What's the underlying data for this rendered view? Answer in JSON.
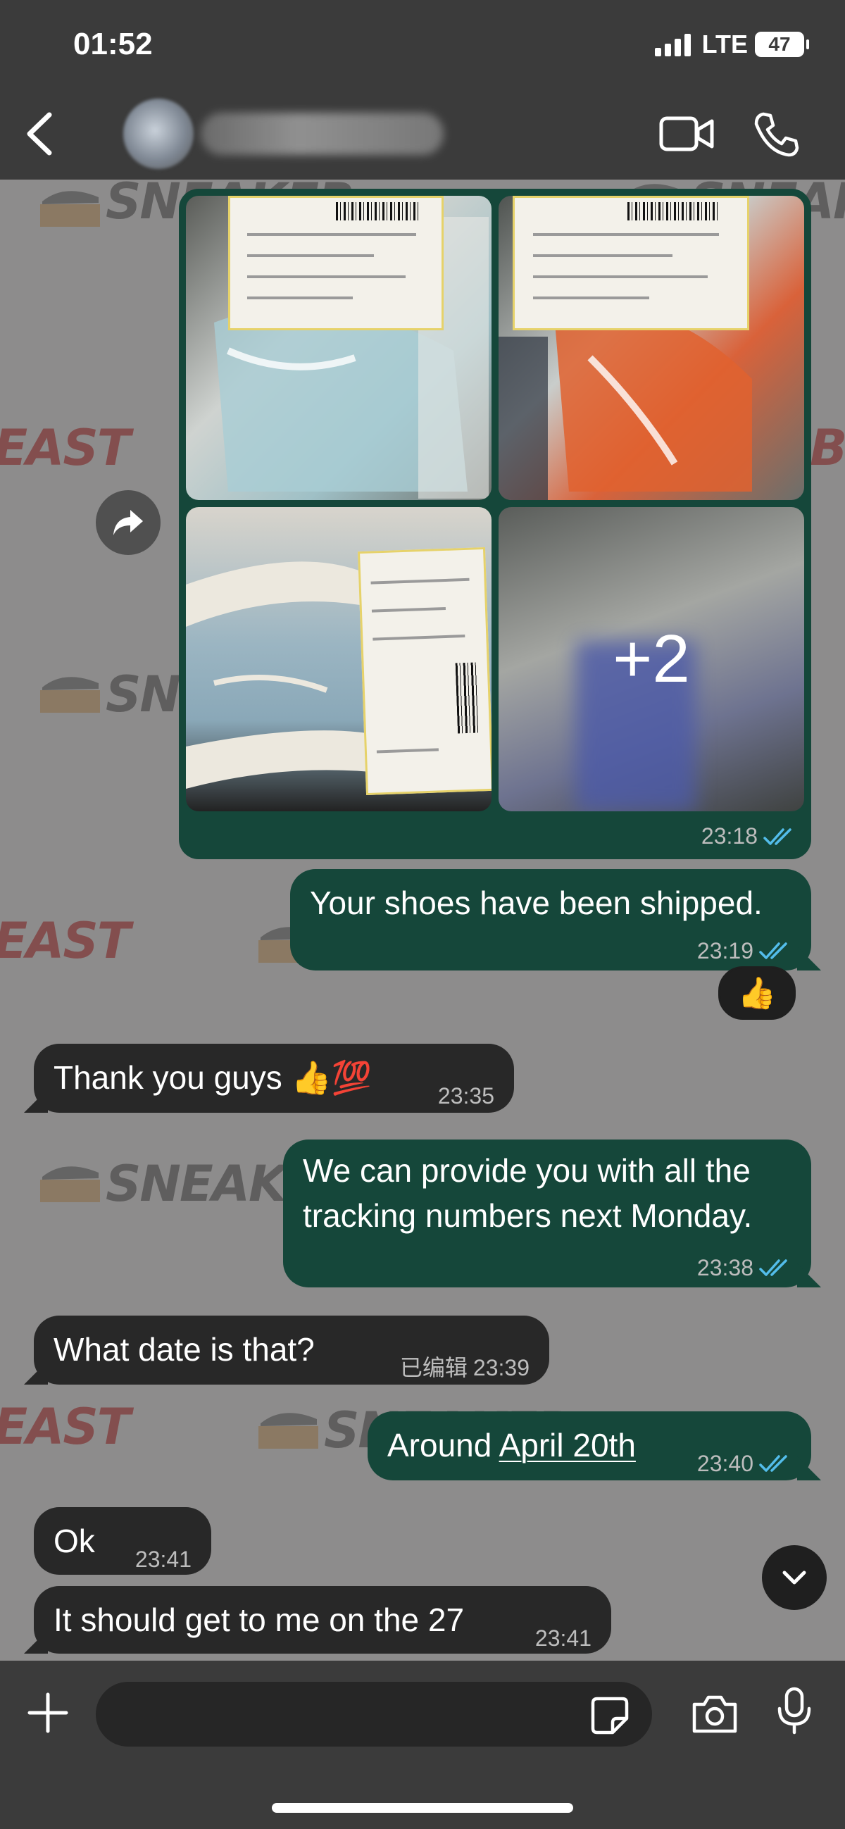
{
  "status_bar": {
    "time": "01:52",
    "network": "LTE",
    "battery": "47"
  },
  "header": {
    "contact_name": "",
    "icons": [
      "chevron-left-icon",
      "video-camera-icon",
      "phone-icon"
    ]
  },
  "wallpaper": {
    "brand_text_a": "SNEAKER",
    "brand_text_b": "BEAST",
    "colors": {
      "dark": "#3a3a3a",
      "red": "#7b1d1d"
    }
  },
  "messages": [
    {
      "id": "album",
      "direction": "out",
      "type": "media",
      "time": "23:18",
      "read": true,
      "extra_count": "+2"
    },
    {
      "id": "m1",
      "direction": "out",
      "text": "Your shoes have been shipped.",
      "time": "23:19",
      "read": true,
      "reaction": "👍"
    },
    {
      "id": "m2",
      "direction": "in",
      "text": "Thank you guys 👍💯",
      "time": "23:35"
    },
    {
      "id": "m3",
      "direction": "out",
      "text_lines": [
        "We can provide you with all the",
        "tracking numbers next Monday."
      ],
      "time": "23:38",
      "read": true
    },
    {
      "id": "m4",
      "direction": "in",
      "text": "What date  is that?",
      "edited": "已编辑",
      "time": "23:39"
    },
    {
      "id": "m5",
      "direction": "out",
      "text": "Around ",
      "link": "April 20th",
      "time": "23:40",
      "read": true
    },
    {
      "id": "m6",
      "direction": "in",
      "text": "Ok",
      "time": "23:41"
    },
    {
      "id": "m7",
      "direction": "in",
      "text": "It should get to me on the 27",
      "time": "23:41"
    }
  ],
  "composer": {
    "placeholder": "",
    "icons": [
      "plus-icon",
      "sticker-icon",
      "camera-icon",
      "microphone-icon"
    ]
  },
  "colors": {
    "outgoing_bubble": "#15473a",
    "incoming_bubble": "#282828",
    "read_ticks": "#53bdeb",
    "bar_background": "#3b3b3b"
  }
}
